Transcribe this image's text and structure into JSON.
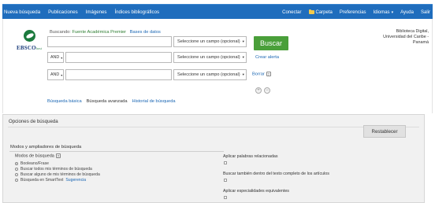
{
  "topbar": {
    "nav": [
      "Nueva búsqueda",
      "Publicaciones",
      "Imágenes",
      "Índices bibliográficos"
    ],
    "connect": "Conectar",
    "folder": "Carpeta",
    "preferences": "Preferencias",
    "languages": "Idiomas",
    "help": "Ayuda",
    "exit": "Salir"
  },
  "logo": {
    "brand": "EBSCO",
    "suffix": "host"
  },
  "search": {
    "searching_label": "Buscando:",
    "database": "Fuente Académica Premier",
    "choose_db": "Bases de datos",
    "search_button": "Buscar",
    "create_alert": "Crear alerta",
    "clear": "Borrar",
    "rows": [
      {
        "bool": "",
        "value": "",
        "field": "Seleccione un campo (opcional)"
      },
      {
        "bool": "AND",
        "value": "",
        "field": "Seleccione un campo (opcional)"
      },
      {
        "bool": "AND",
        "value": "",
        "field": "Seleccione un campo (opcional)"
      }
    ],
    "links": [
      "Búsqueda básica",
      "Búsqueda avanzada",
      "Historial de búsqueda"
    ]
  },
  "institution": [
    "Biblioteca Digital,",
    "Universidad del Caribe -",
    "Panamá"
  ],
  "options": {
    "title": "Opciones de búsqueda",
    "reset": "Restablecer",
    "section": "Modos y ampliadores de búsqueda",
    "modes_label": "Modos de búsqueda",
    "modes": [
      {
        "label": "Booleano/Frase",
        "selected": true
      },
      {
        "label": "Buscar todos mis términos de búsqueda",
        "selected": false
      },
      {
        "label": "Buscar alguno de mis términos de búsqueda",
        "selected": false
      },
      {
        "label": "Búsqueda en SmartText",
        "selected": false,
        "hint": "Sugerencia"
      }
    ],
    "expanders": [
      "Aplicar palabras relacionadas",
      "Buscar también dentro del texto completo de los artículos",
      "Aplicar especialidades equivalentes"
    ]
  },
  "colors": {
    "topbar": "#1f6dbd",
    "search_button": "#4a9f3a",
    "link": "#1a66b3",
    "database": "#2e7d32"
  }
}
